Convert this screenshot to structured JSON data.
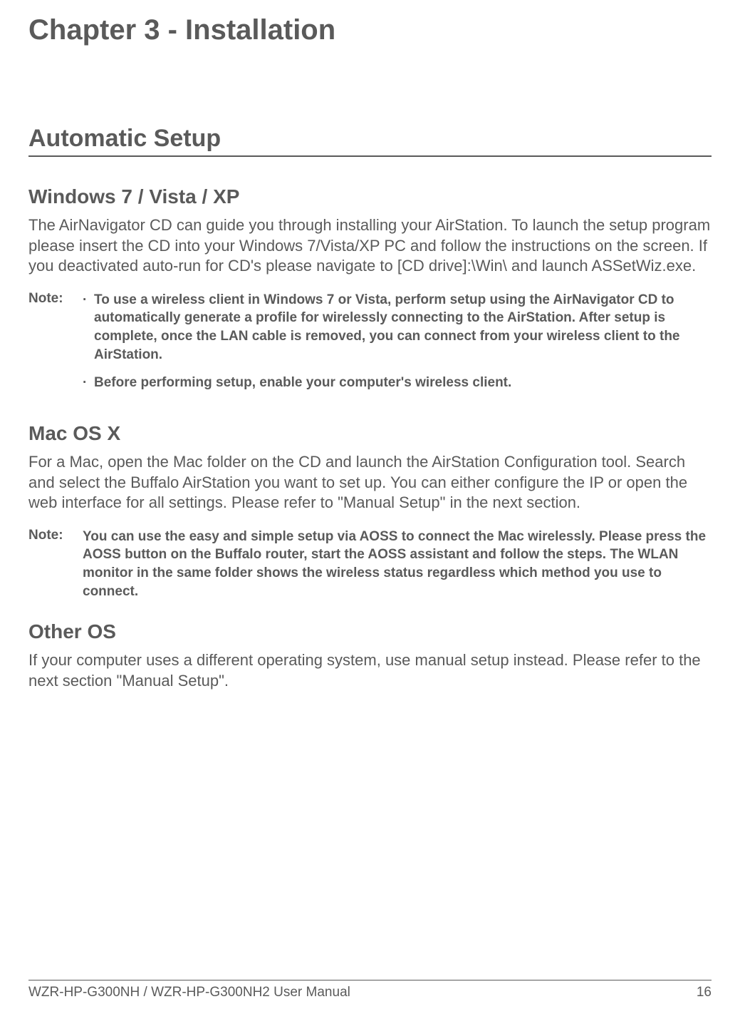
{
  "chapterTitle": "Chapter 3 - Installation",
  "sectionTitle": "Automatic Setup",
  "windows": {
    "heading": "Windows 7 / Vista / XP",
    "body": "The AirNavigator CD can guide you through installing your AirStation. To launch the setup program please insert the CD into your Windows 7/Vista/XP PC and follow the instructions on the screen. If you deactivated auto-run for CD's please navigate to [CD drive]:\\Win\\ and launch ASSetWiz.exe.",
    "noteLabel": "Note:",
    "noteItems": [
      "To use a wireless client in Windows 7 or Vista, perform setup using the AirNavigator CD to automatically generate a profile for wirelessly connecting to the AirStation. After setup is complete, once the LAN cable is removed, you can connect from your wireless client to the AirStation.",
      "Before performing setup, enable your computer's wireless client."
    ]
  },
  "mac": {
    "heading": "Mac OS X",
    "body": "For a Mac, open the Mac folder on the CD and launch the AirStation Configuration tool. Search and select the Buffalo AirStation you want to set up. You can either configure the IP or open the web interface for all settings. Please refer to \"Manual Setup\" in the next section.",
    "noteLabel": "Note:",
    "noteText": "You can use the easy and simple setup via AOSS to connect the Mac wirelessly. Please press the AOSS button on the Buffalo router, start the AOSS assistant and follow the steps. The WLAN monitor in the same folder shows the wireless status regardless which method you use to connect."
  },
  "other": {
    "heading": "Other OS",
    "body": "If your computer uses a different operating system, use manual setup instead. Please refer to the next section \"Manual Setup\"."
  },
  "footer": {
    "left": "WZR-HP-G300NH / WZR-HP-G300NH2 User Manual",
    "right": "16"
  },
  "bullet": "·"
}
